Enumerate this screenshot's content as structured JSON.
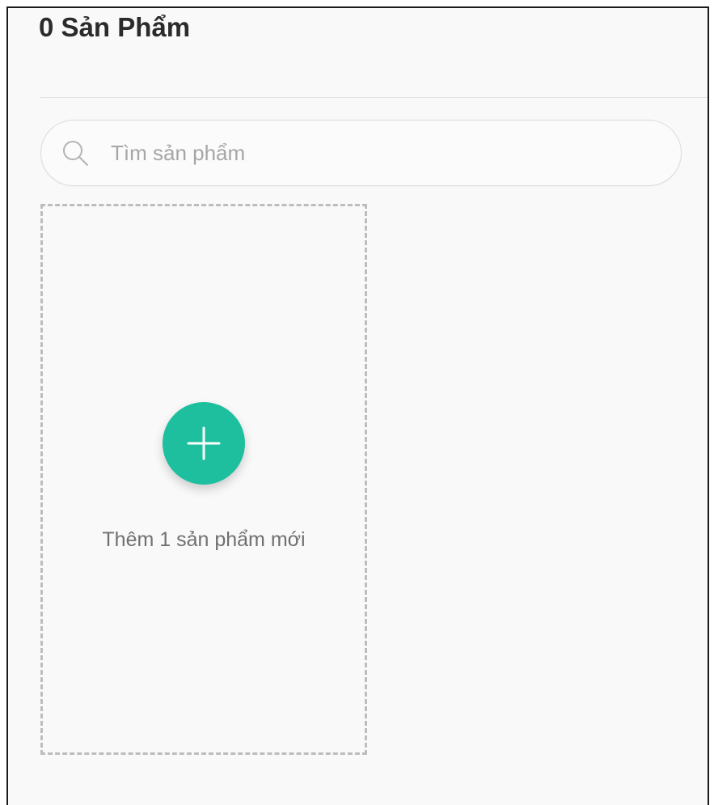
{
  "header": {
    "title": "0 Sản Phẩm"
  },
  "search": {
    "placeholder": "Tìm sản phẩm",
    "value": "",
    "icon": "search-icon"
  },
  "add_product": {
    "label": "Thêm 1 sản phẩm mới",
    "icon": "plus-icon",
    "button_color": "#1dbf9e"
  }
}
